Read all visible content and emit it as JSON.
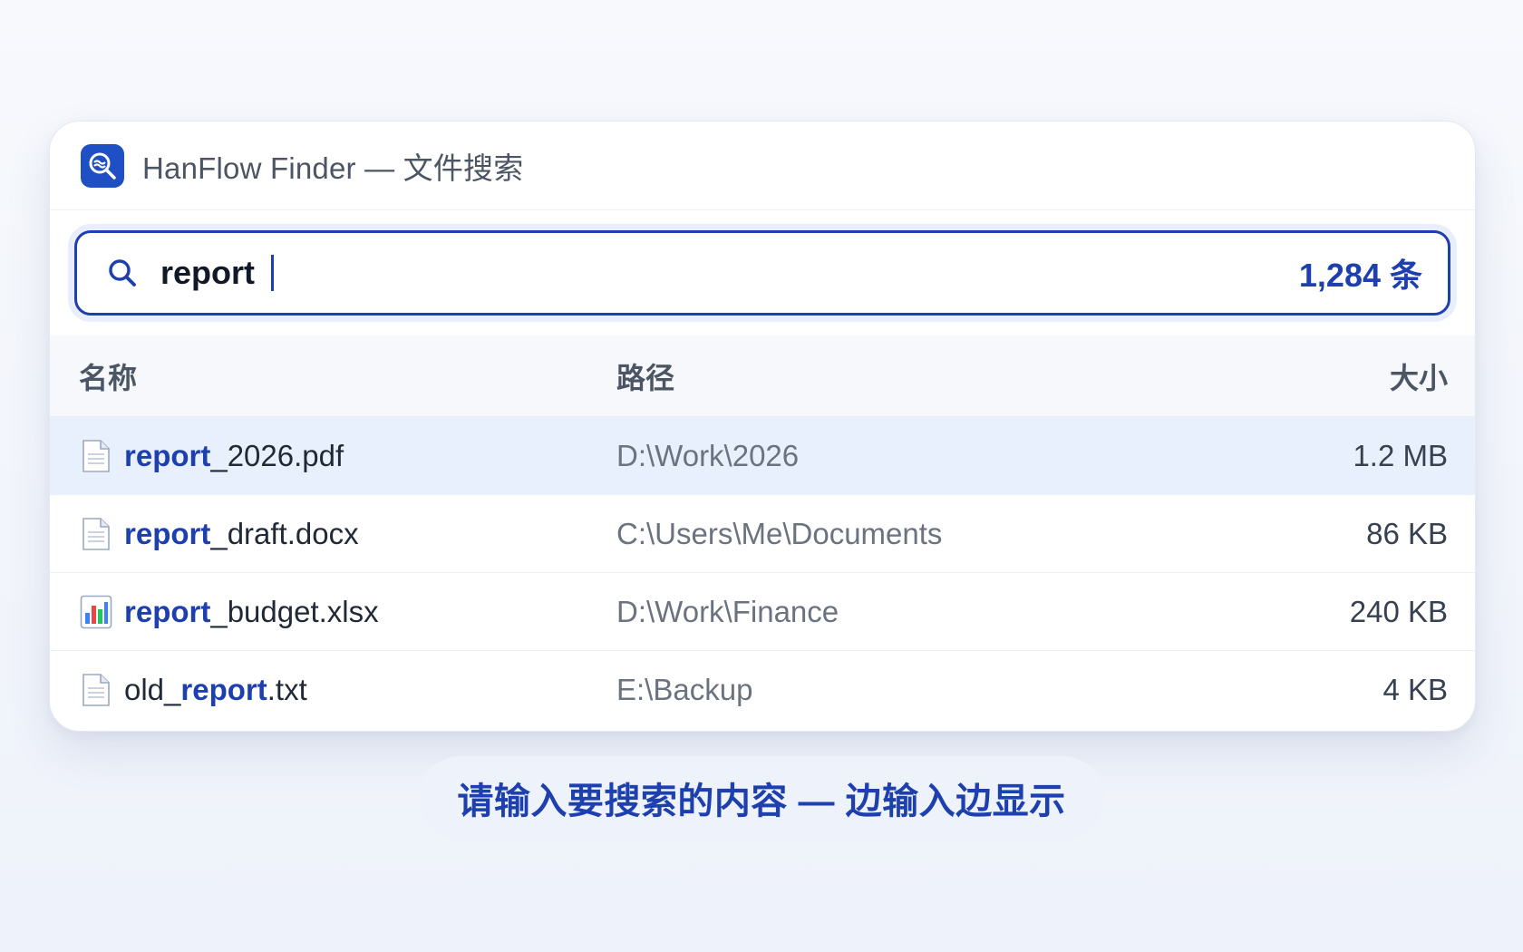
{
  "window": {
    "title": "HanFlow Finder — 文件搜索",
    "app_icon": "search-logo-icon"
  },
  "search": {
    "value": "report",
    "result_count": "1,284 条"
  },
  "table": {
    "columns": {
      "name": "名称",
      "path": "路径",
      "size": "大小"
    },
    "rows": [
      {
        "icon": "document-icon",
        "pre": "",
        "match": "report",
        "post": "_2026.pdf",
        "path": "D:\\Work\\2026",
        "size": "1.2 MB",
        "selected": true
      },
      {
        "icon": "document-icon",
        "pre": "",
        "match": "report",
        "post": "_draft.docx",
        "path": "C:\\Users\\Me\\Documents",
        "size": "86 KB",
        "selected": false
      },
      {
        "icon": "bar-chart-icon",
        "pre": "",
        "match": "report",
        "post": "_budget.xlsx",
        "path": "D:\\Work\\Finance",
        "size": "240 KB",
        "selected": false
      },
      {
        "icon": "document-icon",
        "pre": "old_",
        "match": "report",
        "post": ".txt",
        "path": "E:\\Backup",
        "size": "4 KB",
        "selected": false
      }
    ]
  },
  "hint": "请输入要搜索的内容 — 边输入边显示",
  "colors": {
    "accent": "#1e40af",
    "selected_row": "#e9f0fd",
    "app_icon_bg": "#1f4fc4"
  }
}
